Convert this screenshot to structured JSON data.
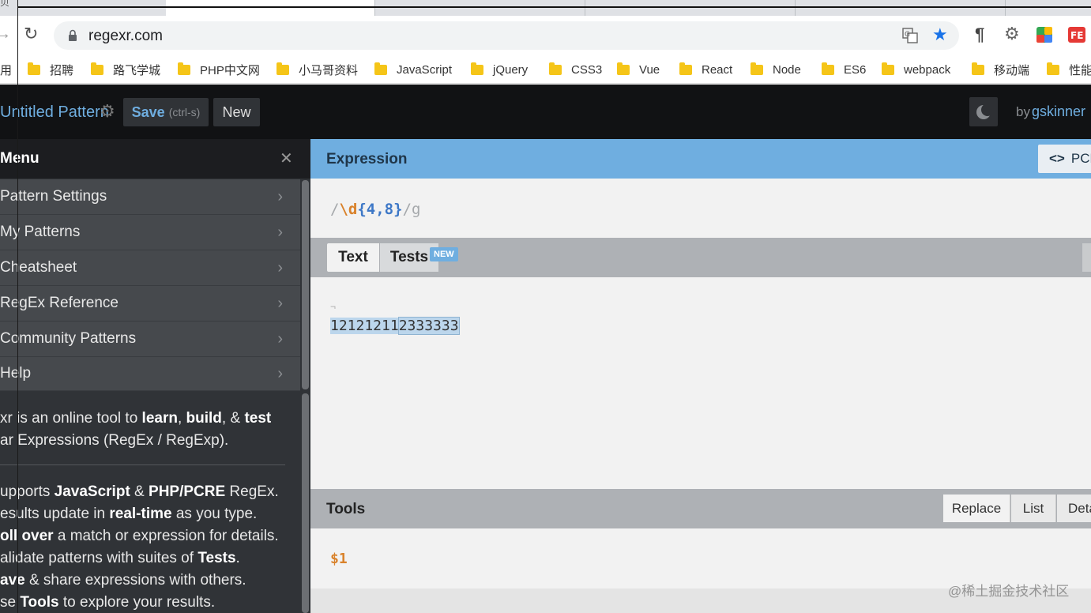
{
  "browser": {
    "url": "regexr.com",
    "tab_label_fragment": "贝",
    "bookmarks_lead": "用",
    "bookmarks": [
      "招聘",
      "路飞学城",
      "PHP中文网",
      "小马哥资料",
      "JavaScript",
      "jQuery",
      "CSS3",
      "Vue",
      "React",
      "Node",
      "ES6",
      "webpack",
      "移动端",
      "性能"
    ],
    "ext_icons": [
      "translate-icon",
      "star-icon",
      "paragraph-icon",
      "gear-icon",
      "chrome-color-icon",
      "fe-icon"
    ]
  },
  "app": {
    "pattern_title": "Untitled Pattern",
    "save_label": "Save",
    "save_shortcut": "(ctrl-s)",
    "new_label": "New",
    "by_label": "by",
    "author": "gskinner"
  },
  "menu": {
    "title": "Menu",
    "close_glyph": "✕",
    "items": [
      "Pattern Settings",
      "My Patterns",
      "Cheatsheet",
      "RegEx Reference",
      "Community Patterns",
      "Help"
    ],
    "desc1_a": "xr is an online tool to ",
    "desc1_learn": "learn",
    "desc1_b": ", ",
    "desc1_build": "build",
    "desc1_c": ", & ",
    "desc1_test": "test",
    "desc2": "ar Expressions (RegEx / RegExp).",
    "f1_a": "upports ",
    "f1_js": "JavaScript",
    "f1_b": " & ",
    "f1_php": "PHP/PCRE",
    "f1_c": " RegEx.",
    "f2_a": "esults update in ",
    "f2_rt": "real-time",
    "f2_b": " as you type.",
    "f3_ro": "oll over",
    "f3_b": " a match or expression for details.",
    "f4_a": "alidate patterns with suites of ",
    "f4_tests": "Tests",
    "f4_b": ".",
    "f5_ave": "ave",
    "f5_b": " & share expressions with others.",
    "f6_a": "se ",
    "f6_tools": "Tools",
    "f6_b": " to explore your results."
  },
  "expression": {
    "header": "Expression",
    "flavor_label": "PCR",
    "flavor_icon": "<>",
    "open_slash": "/",
    "token_d": "\\d",
    "quant_open": "{",
    "quant_inner": "4,8",
    "quant_close": "}",
    "close_slash": "/",
    "flags": "g"
  },
  "text_panel": {
    "tab_text": "Text",
    "tab_tests": "Tests",
    "new_badge": "NEW",
    "match1": "12121211",
    "match2": "2333333"
  },
  "tools": {
    "header": "Tools",
    "tabs": [
      "Replace",
      "List",
      "Deta"
    ],
    "replace_value": "$1"
  },
  "watermark": "@稀土掘金技术社区",
  "colors": {
    "accent": "#6faee0",
    "app_header": "#111214",
    "menu_bg": "#303337",
    "token_orange": "#d9822b",
    "quant_blue": "#3e78c7"
  }
}
